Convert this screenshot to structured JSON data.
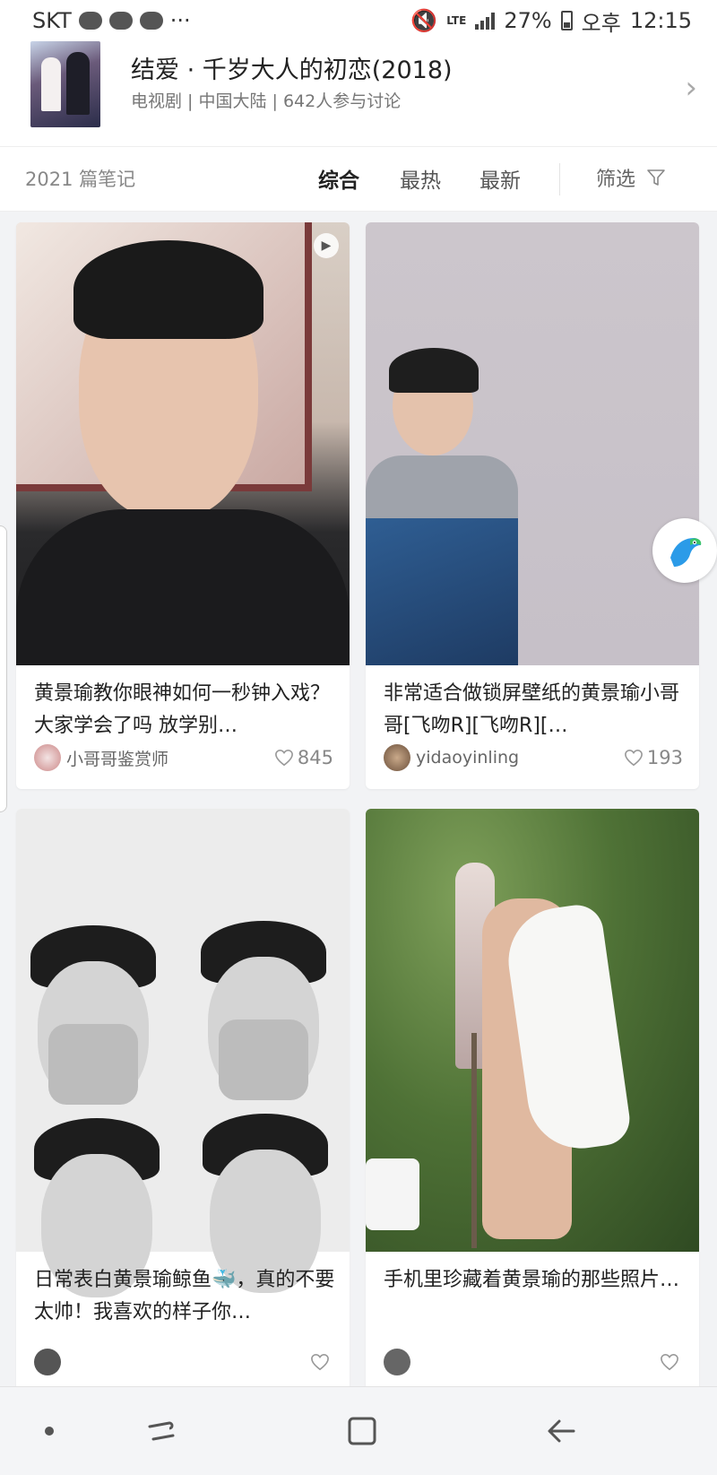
{
  "status_bar": {
    "carrier": "SKT",
    "lte": "LTE",
    "battery": "27%",
    "ampm": "오후",
    "time": "12:15"
  },
  "header": {
    "title": "结爱 · 千岁大人的初恋(2018)",
    "subtitle": "电视剧 | 中国大陆 | 642人参与讨论",
    "poster_icon": "poster-thumbnail",
    "chevron_icon": "chevron-right-icon"
  },
  "filter_bar": {
    "note_count": "2021 篇笔记",
    "tabs": [
      {
        "label": "综合",
        "active": true
      },
      {
        "label": "最热",
        "active": false
      },
      {
        "label": "最新",
        "active": false
      }
    ],
    "filter_label": "筛选",
    "filter_icon": "funnel-icon"
  },
  "cards": [
    {
      "title": "黄景瑜教你眼神如何一秒钟入戏？ 大家学会了吗 放学别…",
      "author": "小哥哥鉴赏师",
      "likes": "845",
      "has_video": true
    },
    {
      "title": "非常适合做锁屏壁纸的黄景瑜小哥哥[飞吻R][飞吻R][…",
      "author": "yidaoyinling",
      "likes": "193",
      "has_video": false
    },
    {
      "title": "日常表白黄景瑜鲸鱼🐳，真的不要太帅！我喜欢的样子你…",
      "author": "",
      "likes": "",
      "has_video": false
    },
    {
      "title": "手机里珍藏着黄景瑜的那些照片…",
      "author": "",
      "likes": "",
      "has_video": false
    }
  ],
  "floating_button": {
    "icon": "parrot-icon"
  },
  "nav_bar": {
    "icons": [
      "dot-icon",
      "recent-apps-icon",
      "home-icon",
      "back-icon"
    ]
  },
  "colors": {
    "background": "#f2f3f5",
    "card": "#ffffff",
    "text_primary": "#222222",
    "text_secondary": "#777777"
  }
}
